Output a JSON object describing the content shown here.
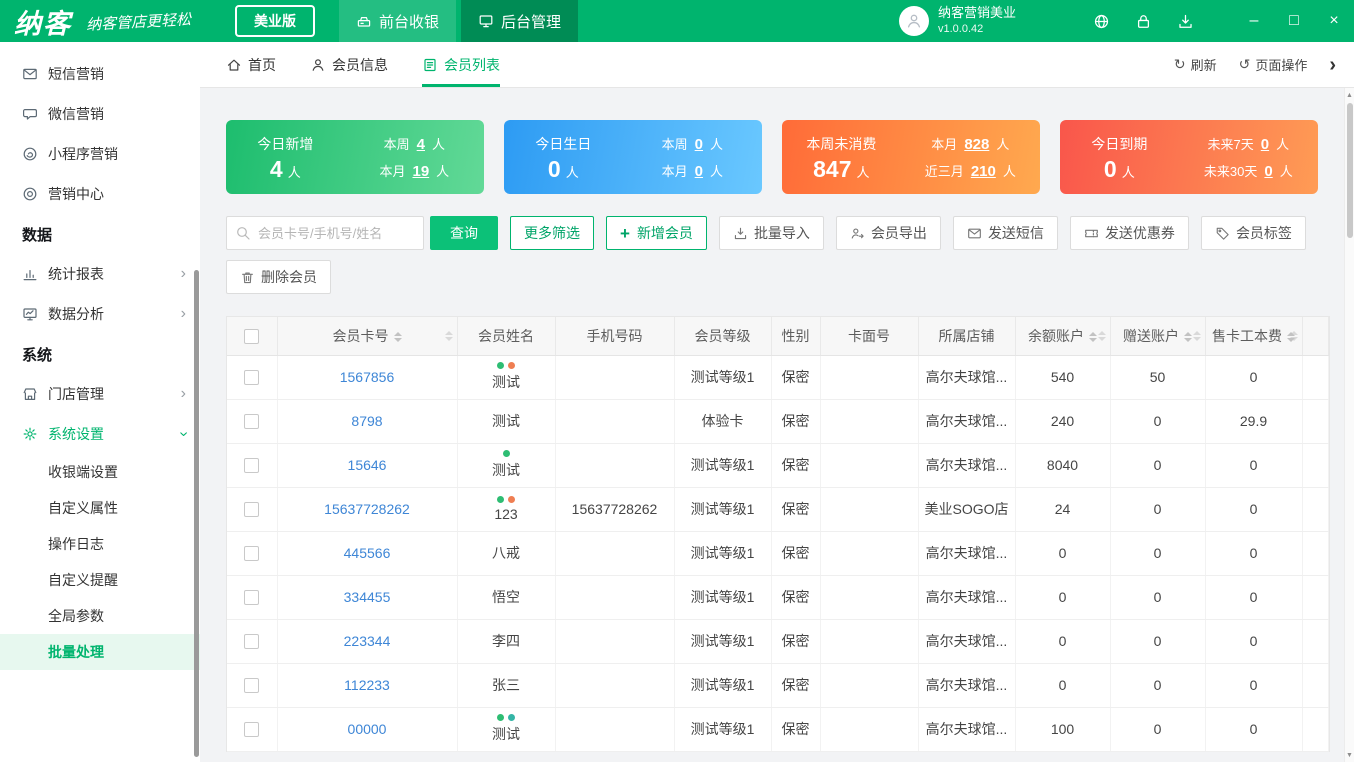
{
  "brand": {
    "logo": "纳客",
    "slogan": "纳客管店更轻松",
    "edition": "美业版",
    "green": "#00b46e"
  },
  "header": {
    "nav": [
      {
        "label": "前台收银"
      },
      {
        "label": "后台管理",
        "active": true
      }
    ],
    "account_name": "纳客营销美业",
    "version": "v1.0.0.42"
  },
  "icons": {
    "refresh": "↻",
    "page_ops": "↺",
    "chevron_right": "›",
    "minimize": "–",
    "maximize": "□",
    "close": "×",
    "plus": "+"
  },
  "sidebar": {
    "items": [
      {
        "label": "短信营销",
        "icon": "envelope"
      },
      {
        "label": "微信营销",
        "icon": "chat-bubble"
      },
      {
        "label": "小程序营销",
        "icon": "mini-program"
      },
      {
        "label": "营销中心",
        "icon": "target"
      },
      {
        "label": "数据",
        "type": "section"
      },
      {
        "label": "统计报表",
        "icon": "bar-chart",
        "chevron": "right"
      },
      {
        "label": "数据分析",
        "icon": "monitor",
        "chevron": "right"
      },
      {
        "label": "系统",
        "type": "section"
      },
      {
        "label": "门店管理",
        "icon": "shop",
        "chevron": "right"
      },
      {
        "label": "系统设置",
        "icon": "gear",
        "chevron": "down",
        "active": true
      },
      {
        "label": "收银端设置",
        "type": "sub"
      },
      {
        "label": "自定义属性",
        "type": "sub"
      },
      {
        "label": "操作日志",
        "type": "sub"
      },
      {
        "label": "自定义提醒",
        "type": "sub"
      },
      {
        "label": "全局参数",
        "type": "sub"
      },
      {
        "label": "批量处理",
        "type": "sub",
        "selected": true
      }
    ]
  },
  "tabbar": {
    "tabs": [
      {
        "label": "首页",
        "icon": "home",
        "name": "home"
      },
      {
        "label": "会员信息",
        "icon": "person",
        "name": "member-info"
      },
      {
        "label": "会员列表",
        "icon": "document",
        "name": "member-list",
        "active": true
      }
    ],
    "refresh": "刷新",
    "page_ops": "页面操作"
  },
  "stats": [
    {
      "title": "今日新增",
      "value": "4",
      "unit": "人",
      "color_from": "#1dbd6e",
      "color_to": "#62d997",
      "detail": [
        {
          "label": "本周",
          "value": "4",
          "unit": "人"
        },
        {
          "label": "本月",
          "value": "19",
          "unit": "人"
        }
      ]
    },
    {
      "title": "今日生日",
      "value": "0",
      "unit": "人",
      "color_from": "#2d9bf3",
      "color_to": "#6ac8ff",
      "detail": [
        {
          "label": "本周",
          "value": "0",
          "unit": "人"
        },
        {
          "label": "本月",
          "value": "0",
          "unit": "人"
        }
      ]
    },
    {
      "title": "本周未消费",
      "value": "847",
      "unit": "人",
      "color_from": "#ff6b38",
      "color_to": "#ffa94f",
      "detail": [
        {
          "label": "本月",
          "value": "828",
          "unit": "人"
        },
        {
          "label": "近三月",
          "value": "210",
          "unit": "人"
        }
      ]
    },
    {
      "title": "今日到期",
      "value": "0",
      "unit": "人",
      "color_from": "#f9564b",
      "color_to": "#ff9c55",
      "detail": [
        {
          "label": "未来7天",
          "value": "0",
          "unit": "人"
        },
        {
          "label": "未来30天",
          "value": "0",
          "unit": "人"
        }
      ]
    }
  ],
  "toolbar": {
    "search_placeholder": "会员卡号/手机号/姓名",
    "search_label": "查询",
    "more_filters": "更多筛选",
    "add_member": "新增会员",
    "buttons": [
      {
        "label": "批量导入",
        "icon": "import-box",
        "name": "batch-import"
      },
      {
        "label": "会员导出",
        "icon": "export-person",
        "name": "member-export"
      },
      {
        "label": "发送短信",
        "icon": "envelope",
        "name": "send-sms"
      },
      {
        "label": "发送优惠券",
        "icon": "coupon",
        "name": "send-coupon"
      },
      {
        "label": "会员标签",
        "icon": "tag",
        "name": "member-tags"
      }
    ],
    "delete_member": "删除会员"
  },
  "table": {
    "columns": [
      {
        "type": "checkbox"
      },
      {
        "label": "会员卡号",
        "sortable": true
      },
      {
        "label": "会员姓名"
      },
      {
        "label": "手机号码"
      },
      {
        "label": "会员等级"
      },
      {
        "label": "性别"
      },
      {
        "label": "卡面号"
      },
      {
        "label": "所属店铺"
      },
      {
        "label": "余额账户",
        "sortable": true
      },
      {
        "label": "赠送账户",
        "sortable": true
      },
      {
        "label": "售卡工本费",
        "sortable": true
      }
    ],
    "rows": [
      {
        "card_no": "1567856",
        "name": "测试",
        "dots": [
          "#2ebd73",
          "#ef7e52"
        ],
        "phone": "",
        "level": "测试等级1",
        "gender": "保密",
        "card_face": "",
        "store": "高尔夫球馆...",
        "balance": "540",
        "gift": "50",
        "fee": "0"
      },
      {
        "card_no": "8798",
        "name": "测试",
        "dots": [],
        "phone": "",
        "level": "体验卡",
        "gender": "保密",
        "card_face": "",
        "store": "高尔夫球馆...",
        "balance": "240",
        "gift": "0",
        "fee": "29.9"
      },
      {
        "card_no": "15646",
        "name": "测试",
        "dots": [
          "#2ebd73"
        ],
        "phone": "",
        "level": "测试等级1",
        "gender": "保密",
        "card_face": "",
        "store": "高尔夫球馆...",
        "balance": "8040",
        "gift": "0",
        "fee": "0"
      },
      {
        "card_no": "15637728262",
        "name": "123",
        "dots": [
          "#2ebd73",
          "#ef7e52"
        ],
        "phone": "15637728262",
        "level": "测试等级1",
        "gender": "保密",
        "card_face": "",
        "store": "美业SOGO店",
        "balance": "24",
        "gift": "0",
        "fee": "0"
      },
      {
        "card_no": "445566",
        "name": "八戒",
        "dots": [],
        "phone": "",
        "level": "测试等级1",
        "gender": "保密",
        "card_face": "",
        "store": "高尔夫球馆...",
        "balance": "0",
        "gift": "0",
        "fee": "0"
      },
      {
        "card_no": "334455",
        "name": "悟空",
        "dots": [],
        "phone": "",
        "level": "测试等级1",
        "gender": "保密",
        "card_face": "",
        "store": "高尔夫球馆...",
        "balance": "0",
        "gift": "0",
        "fee": "0"
      },
      {
        "card_no": "223344",
        "name": "李四",
        "dots": [],
        "phone": "",
        "level": "测试等级1",
        "gender": "保密",
        "card_face": "",
        "store": "高尔夫球馆...",
        "balance": "0",
        "gift": "0",
        "fee": "0"
      },
      {
        "card_no": "112233",
        "name": "张三",
        "dots": [],
        "phone": "",
        "level": "测试等级1",
        "gender": "保密",
        "card_face": "",
        "store": "高尔夫球馆...",
        "balance": "0",
        "gift": "0",
        "fee": "0"
      },
      {
        "card_no": "00000",
        "name": "测试",
        "dots": [
          "#2ebd73",
          "#34b5a6"
        ],
        "phone": "",
        "level": "测试等级1",
        "gender": "保密",
        "card_face": "",
        "store": "高尔夫球馆...",
        "balance": "100",
        "gift": "0",
        "fee": "0"
      }
    ]
  }
}
